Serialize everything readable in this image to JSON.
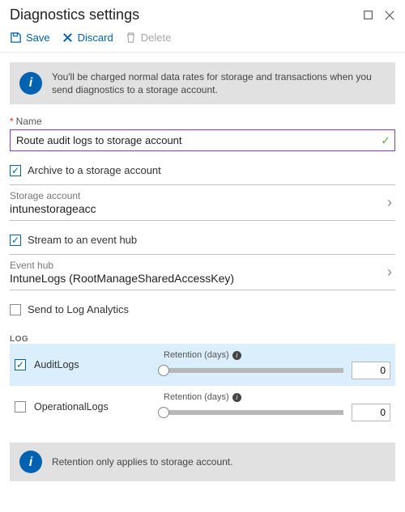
{
  "header": {
    "title": "Diagnostics settings"
  },
  "commands": {
    "save": "Save",
    "discard": "Discard",
    "delete": "Delete"
  },
  "info_top": "You'll be charged normal data rates for storage and transactions when you send diagnostics to a storage account.",
  "name_field": {
    "label": "Name",
    "value": "Route audit logs to storage account"
  },
  "archive": {
    "label": "Archive to a storage account",
    "checked": true
  },
  "storage_picker": {
    "label": "Storage account",
    "value": "intunestorageacc"
  },
  "stream": {
    "label": "Stream to an event hub",
    "checked": true
  },
  "eventhub_picker": {
    "label": "Event hub",
    "value": "IntuneLogs (RootManageSharedAccessKey)"
  },
  "log_analytics": {
    "label": "Send to Log Analytics",
    "checked": false
  },
  "log_section": {
    "heading": "LOG",
    "retention_label": "Retention (days)",
    "rows": [
      {
        "name": "AuditLogs",
        "checked": true,
        "retention": "0"
      },
      {
        "name": "OperationalLogs",
        "checked": false,
        "retention": "0"
      }
    ]
  },
  "info_bottom": "Retention only applies to storage account."
}
